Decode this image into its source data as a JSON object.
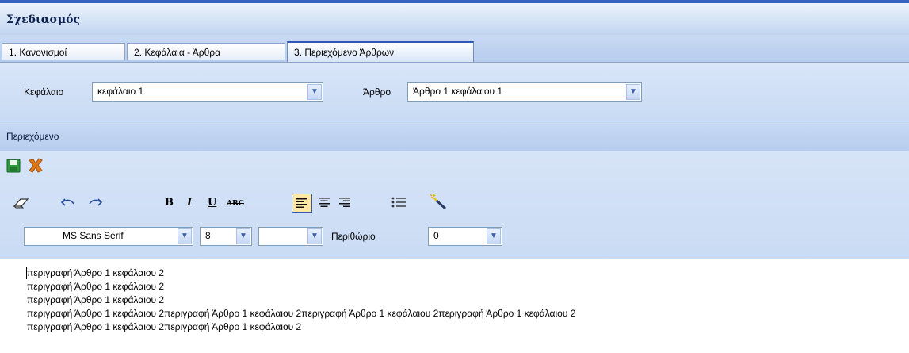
{
  "window": {
    "title": "Σχεδιασμός"
  },
  "tabs": [
    {
      "label": "1. Κανονισμοί",
      "active": false
    },
    {
      "label": "2. Κεφάλαια - Άρθρα",
      "active": false
    },
    {
      "label": "3. Περιεχόμενο Άρθρων",
      "active": true
    }
  ],
  "form": {
    "chapter_label": "Κεφάλαιο",
    "chapter_value": "κεφάλαιο 1",
    "article_label": "Άρθρο",
    "article_value": "Άρθρο 1 κεφάλαιου 1"
  },
  "section": {
    "title": "Περιεχόμενο"
  },
  "toolbar": {
    "icons": [
      "save-icon",
      "cancel-icon",
      "eraser-icon",
      "undo-icon",
      "redo-icon",
      "bold-icon",
      "italic-icon",
      "underline-icon",
      "strikethrough-icon",
      "align-left-icon",
      "align-center-icon",
      "align-right-icon",
      "bullet-list-icon",
      "magic-wand-icon"
    ],
    "bold": "B",
    "italic": "I",
    "underline": "U",
    "strikethrough": "ABC",
    "font_name": "MS Sans Serif",
    "font_size": "8",
    "color_value": "",
    "margin_label": "Περιθώριο",
    "margin_value": "0"
  },
  "editor": {
    "lines": [
      "περιγραφή Άρθρο 1 κεφάλαιου 2",
      "περιγραφή Άρθρο 1 κεφάλαιου 2",
      "περιγραφή Άρθρο 1 κεφάλαιου 2",
      "περιγραφή Άρθρο 1 κεφάλαιου 2περιγραφή Άρθρο 1 κεφάλαιου 2περιγραφή Άρθρο 1 κεφάλαιου 2περιγραφή Άρθρο 1 κεφάλαιου 2",
      "περιγραφή Άρθρο 1 κεφάλαιου 2περιγραφή Άρθρο 1 κεφάλαιου 2"
    ]
  },
  "colors": {
    "accent": "#2d56b5",
    "panel": "#c8daf4",
    "save_green": "#2a9a3a",
    "cancel_orange": "#e07a1a"
  }
}
